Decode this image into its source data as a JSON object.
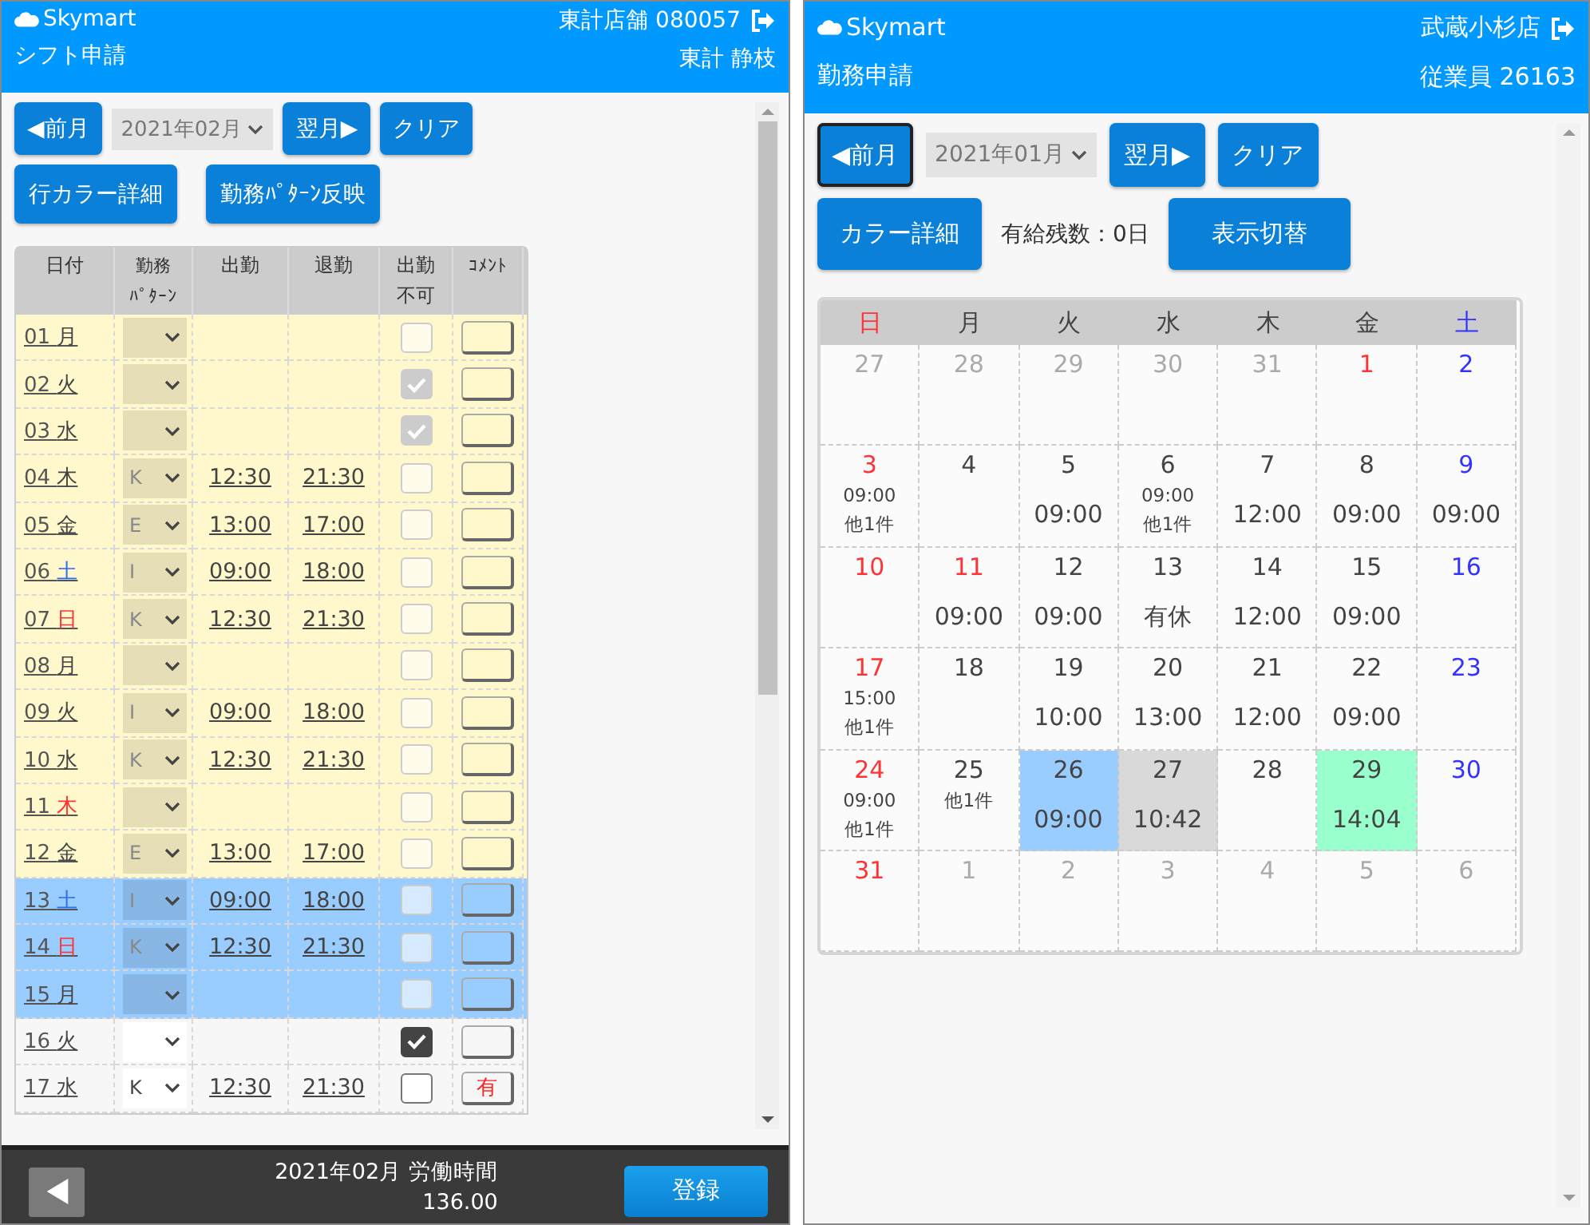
{
  "shift_screen": {
    "header": {
      "brand": "Skymart",
      "title": "シフト申請",
      "store": "東計店舗 080057",
      "user": "東計 静枝"
    },
    "toolbar": {
      "prev": {
        "label": "◀前月",
        "focused": false
      },
      "month": "2021年02月",
      "next": "翌月▶",
      "clear": "クリア"
    },
    "actions": [
      "行カラー詳細",
      "勤務ﾊﾟﾀｰﾝ反映"
    ],
    "columns": [
      [
        "日付"
      ],
      [
        "勤務",
        "ﾊﾟﾀｰﾝ"
      ],
      [
        "出勤"
      ],
      [
        "退勤"
      ],
      [
        "出勤",
        "不可"
      ],
      [
        "ｺﾒﾝﾄ"
      ]
    ],
    "rows": [
      {
        "date": "01",
        "weekday": "月",
        "kind": "weekday",
        "color": "#fff8cc",
        "locked": true,
        "pattern": "",
        "start": "",
        "end": "",
        "checked": false,
        "comment": ""
      },
      {
        "date": "02",
        "weekday": "火",
        "kind": "weekday",
        "color": "#fff8cc",
        "locked": true,
        "pattern": "",
        "start": "",
        "end": "",
        "checked": true,
        "comment": ""
      },
      {
        "date": "03",
        "weekday": "水",
        "kind": "weekday",
        "color": "#fff8cc",
        "locked": true,
        "pattern": "",
        "start": "",
        "end": "",
        "checked": true,
        "comment": ""
      },
      {
        "date": "04",
        "weekday": "木",
        "kind": "weekday",
        "color": "#fff8cc",
        "locked": true,
        "pattern": "K",
        "start": "12:30",
        "end": "21:30",
        "checked": false,
        "comment": ""
      },
      {
        "date": "05",
        "weekday": "金",
        "kind": "weekday",
        "color": "#fff8cc",
        "locked": true,
        "pattern": "E",
        "start": "13:00",
        "end": "17:00",
        "checked": false,
        "comment": ""
      },
      {
        "date": "06",
        "weekday": "土",
        "kind": "saturday",
        "color": "#fff8cc",
        "locked": true,
        "pattern": "I",
        "start": "09:00",
        "end": "18:00",
        "checked": false,
        "comment": ""
      },
      {
        "date": "07",
        "weekday": "日",
        "kind": "sunday",
        "color": "#fff8cc",
        "locked": true,
        "pattern": "K",
        "start": "12:30",
        "end": "21:30",
        "checked": false,
        "comment": ""
      },
      {
        "date": "08",
        "weekday": "月",
        "kind": "weekday",
        "color": "#fff8cc",
        "locked": true,
        "pattern": "",
        "start": "",
        "end": "",
        "checked": false,
        "comment": ""
      },
      {
        "date": "09",
        "weekday": "火",
        "kind": "weekday",
        "color": "#fff8cc",
        "locked": true,
        "pattern": "I",
        "start": "09:00",
        "end": "18:00",
        "checked": false,
        "comment": ""
      },
      {
        "date": "10",
        "weekday": "水",
        "kind": "weekday",
        "color": "#fff8cc",
        "locked": true,
        "pattern": "K",
        "start": "12:30",
        "end": "21:30",
        "checked": false,
        "comment": ""
      },
      {
        "date": "11",
        "weekday": "木",
        "kind": "holiday",
        "color": "#fff8cc",
        "locked": true,
        "pattern": "",
        "start": "",
        "end": "",
        "checked": false,
        "comment": ""
      },
      {
        "date": "12",
        "weekday": "金",
        "kind": "weekday",
        "color": "#fff8cc",
        "locked": true,
        "pattern": "E",
        "start": "13:00",
        "end": "17:00",
        "checked": false,
        "comment": ""
      },
      {
        "date": "13",
        "weekday": "土",
        "kind": "saturday",
        "color": "#99ccff",
        "locked": true,
        "pattern": "I",
        "start": "09:00",
        "end": "18:00",
        "checked": false,
        "comment": ""
      },
      {
        "date": "14",
        "weekday": "日",
        "kind": "sunday",
        "color": "#99ccff",
        "locked": true,
        "pattern": "K",
        "start": "12:30",
        "end": "21:30",
        "checked": false,
        "comment": ""
      },
      {
        "date": "15",
        "weekday": "月",
        "kind": "weekday",
        "color": "#99ccff",
        "locked": true,
        "pattern": "",
        "start": "",
        "end": "",
        "checked": false,
        "comment": ""
      },
      {
        "date": "16",
        "weekday": "火",
        "kind": "weekday",
        "color": "#f7f7f7",
        "locked": false,
        "pattern": "",
        "start": "",
        "end": "",
        "checked": true,
        "comment": ""
      },
      {
        "date": "17",
        "weekday": "水",
        "kind": "weekday",
        "color": "#f7f7f7",
        "locked": false,
        "pattern": "K",
        "start": "12:30",
        "end": "21:30",
        "checked": false,
        "comment": "有"
      }
    ],
    "footer": {
      "summary": "2021年02月 労働時間",
      "hours": "136.00",
      "submit": "登録"
    }
  },
  "attendance_screen": {
    "header": {
      "brand": "Skymart",
      "title": "勤務申請",
      "store": "武蔵小杉店",
      "user": "従業員 26163"
    },
    "toolbar": {
      "prev": {
        "label": "◀前月",
        "focused": true
      },
      "month": "2021年01月",
      "next": "翌月▶",
      "clear": "クリア"
    },
    "color_button": "カラー詳細",
    "leave_balance": "有給残数：0日",
    "toggle_button": "表示切替",
    "weekdays": [
      {
        "label": "日",
        "kind": "sunday"
      },
      {
        "label": "月",
        "kind": "weekday"
      },
      {
        "label": "火",
        "kind": "weekday"
      },
      {
        "label": "水",
        "kind": "weekday"
      },
      {
        "label": "木",
        "kind": "weekday"
      },
      {
        "label": "金",
        "kind": "weekday"
      },
      {
        "label": "土",
        "kind": "saturday"
      }
    ],
    "weeks": [
      [
        {
          "day": "27",
          "in_month": false
        },
        {
          "day": "28",
          "in_month": false
        },
        {
          "day": "29",
          "in_month": false
        },
        {
          "day": "30",
          "in_month": false
        },
        {
          "day": "31",
          "in_month": false
        },
        {
          "day": "1",
          "in_month": true,
          "kind": "holiday"
        },
        {
          "day": "2",
          "in_month": true,
          "kind": "saturday"
        }
      ],
      [
        {
          "day": "3",
          "in_month": true,
          "kind": "sunday",
          "notes": [
            "09:00",
            "他1件"
          ]
        },
        {
          "day": "4",
          "in_month": true,
          "kind": "weekday"
        },
        {
          "day": "5",
          "in_month": true,
          "kind": "weekday",
          "time": "09:00"
        },
        {
          "day": "6",
          "in_month": true,
          "kind": "weekday",
          "notes": [
            "09:00",
            "他1件"
          ]
        },
        {
          "day": "7",
          "in_month": true,
          "kind": "weekday",
          "time": "12:00"
        },
        {
          "day": "8",
          "in_month": true,
          "kind": "weekday",
          "time": "09:00"
        },
        {
          "day": "9",
          "in_month": true,
          "kind": "saturday",
          "time": "09:00"
        }
      ],
      [
        {
          "day": "10",
          "in_month": true,
          "kind": "sunday"
        },
        {
          "day": "11",
          "in_month": true,
          "kind": "holiday",
          "time": "09:00"
        },
        {
          "day": "12",
          "in_month": true,
          "kind": "weekday",
          "time": "09:00"
        },
        {
          "day": "13",
          "in_month": true,
          "kind": "weekday",
          "time": "有休"
        },
        {
          "day": "14",
          "in_month": true,
          "kind": "weekday",
          "time": "12:00"
        },
        {
          "day": "15",
          "in_month": true,
          "kind": "weekday",
          "time": "09:00"
        },
        {
          "day": "16",
          "in_month": true,
          "kind": "saturday"
        }
      ],
      [
        {
          "day": "17",
          "in_month": true,
          "kind": "sunday",
          "notes": [
            "15:00",
            "他1件"
          ]
        },
        {
          "day": "18",
          "in_month": true,
          "kind": "weekday"
        },
        {
          "day": "19",
          "in_month": true,
          "kind": "weekday",
          "time": "10:00"
        },
        {
          "day": "20",
          "in_month": true,
          "kind": "weekday",
          "time": "13:00"
        },
        {
          "day": "21",
          "in_month": true,
          "kind": "weekday",
          "time": "12:00"
        },
        {
          "day": "22",
          "in_month": true,
          "kind": "weekday",
          "time": "09:00"
        },
        {
          "day": "23",
          "in_month": true,
          "kind": "saturday"
        }
      ],
      [
        {
          "day": "24",
          "in_month": true,
          "kind": "sunday",
          "notes": [
            "09:00",
            "他1件"
          ]
        },
        {
          "day": "25",
          "in_month": true,
          "kind": "weekday",
          "notes": [
            "他1件"
          ]
        },
        {
          "day": "26",
          "in_month": true,
          "kind": "weekday",
          "time": "09:00",
          "color": "#99ccff"
        },
        {
          "day": "27",
          "in_month": true,
          "kind": "weekday",
          "time": "10:42",
          "color": "#d9d9d9"
        },
        {
          "day": "28",
          "in_month": true,
          "kind": "weekday"
        },
        {
          "day": "29",
          "in_month": true,
          "kind": "weekday",
          "time": "14:04",
          "color": "#99ffcc"
        },
        {
          "day": "30",
          "in_month": true,
          "kind": "saturday"
        }
      ],
      [
        {
          "day": "31",
          "in_month": true,
          "kind": "sunday"
        },
        {
          "day": "1",
          "in_month": false
        },
        {
          "day": "2",
          "in_month": false
        },
        {
          "day": "3",
          "in_month": false
        },
        {
          "day": "4",
          "in_month": false
        },
        {
          "day": "5",
          "in_month": false
        },
        {
          "day": "6",
          "in_month": false
        }
      ]
    ]
  }
}
